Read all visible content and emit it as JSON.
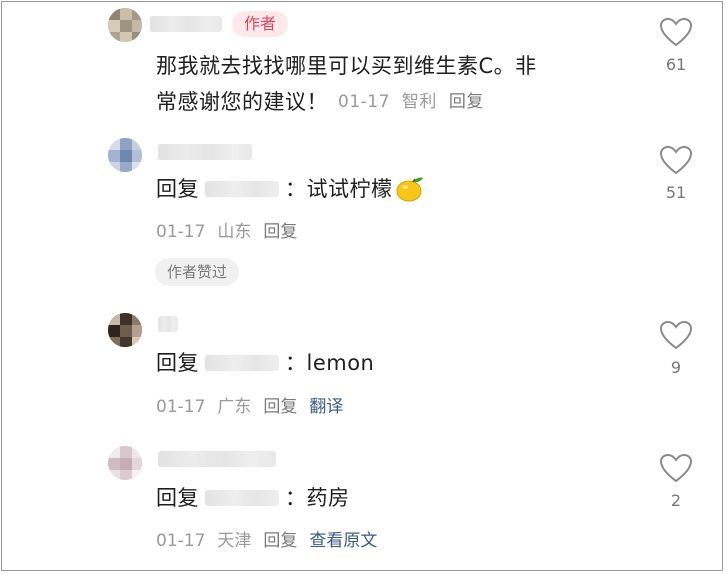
{
  "colors": {
    "author_tag_bg": "#fde9ec",
    "author_tag_text": "#e8435a",
    "link": "#3b5b88",
    "meta": "#9a9a9a"
  },
  "comments": [
    {
      "author_tag": "作者",
      "text": "那我就去找找哪里可以买到维生素C。非常感谢您的建议！",
      "text_line1": "那我就去找找哪里可以买到维生素C。非",
      "text_line2": "常感谢您的建议！",
      "date": "01-17",
      "location": "智利",
      "reply": "回复",
      "likes": "61"
    },
    {
      "reply_prefix": "回复",
      "separator": "：",
      "text": "试试柠檬",
      "emoji": "lemon-emoji",
      "date": "01-17",
      "location": "山东",
      "reply": "回复",
      "liked_by_author": "作者赞过",
      "likes": "51"
    },
    {
      "reply_prefix": "回复",
      "separator": "：",
      "text": "lemon",
      "date": "01-17",
      "location": "广东",
      "reply": "回复",
      "extra_action": "翻译",
      "likes": "9"
    },
    {
      "reply_prefix": "回复",
      "separator": "：",
      "text": "药房",
      "date": "01-17",
      "location": "天津",
      "reply": "回复",
      "extra_action": "查看原文",
      "likes": "2"
    }
  ]
}
